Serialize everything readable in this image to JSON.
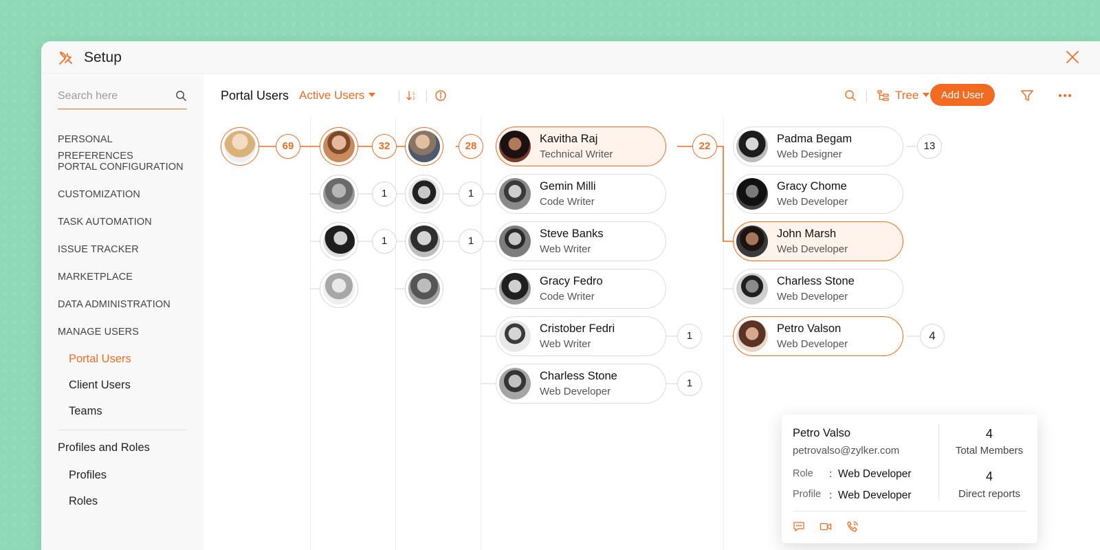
{
  "window": {
    "title": "Setup"
  },
  "sidebar": {
    "search_placeholder": "Search here",
    "items": [
      {
        "label": "PERSONAL PREFERENCES"
      },
      {
        "label": "PORTAL CONFIGURATION"
      },
      {
        "label": "CUSTOMIZATION"
      },
      {
        "label": "TASK AUTOMATION"
      },
      {
        "label": "ISSUE TRACKER"
      },
      {
        "label": "MARKETPLACE"
      },
      {
        "label": "DATA ADMINISTRATION"
      },
      {
        "label": "MANAGE USERS"
      }
    ],
    "manage_users_sub": [
      {
        "label": "Portal Users",
        "active": true
      },
      {
        "label": "Client Users"
      },
      {
        "label": "Teams"
      }
    ],
    "profiles_heading": "Profiles and Roles",
    "profiles_sub": [
      {
        "label": "Profiles"
      },
      {
        "label": "Roles"
      }
    ]
  },
  "toolbar": {
    "title": "Portal Users",
    "filter_label": "Active Users",
    "view_label": "Tree",
    "add_user_label": "Add User"
  },
  "tree": {
    "col1": [
      {
        "count": "69",
        "selected": true,
        "has_count": true
      }
    ],
    "col2": [
      {
        "count": "32",
        "selected": true,
        "has_count": true
      },
      {
        "count": "1",
        "has_count": true
      },
      {
        "count": "1",
        "has_count": true
      },
      {
        "count": "",
        "has_count": false
      }
    ],
    "col3": [
      {
        "count": "28",
        "selected": true,
        "has_count": true
      },
      {
        "count": "1",
        "has_count": true
      },
      {
        "count": "1",
        "has_count": true
      },
      {
        "count": "",
        "has_count": false
      }
    ],
    "col4": [
      {
        "name": "Kavitha Raj",
        "role": "Technical Writer",
        "count": "22",
        "selected": true,
        "has_count": true
      },
      {
        "name": "Gemin Milli",
        "role": "Code Writer",
        "count": "",
        "has_count": false
      },
      {
        "name": "Steve Banks",
        "role": "Web Writer",
        "count": "",
        "has_count": false
      },
      {
        "name": "Gracy Fedro",
        "role": "Code Writer",
        "count": "",
        "has_count": false
      },
      {
        "name": "Cristober Fedri",
        "role": "Web Writer",
        "count": "1",
        "has_count": true
      },
      {
        "name": "Charless Stone",
        "role": "Web Developer",
        "count": "1",
        "has_count": true
      }
    ],
    "col5": [
      {
        "name": "Padma Begam",
        "role": "Web Designer",
        "count": "13",
        "has_count": true
      },
      {
        "name": "Gracy Chome",
        "role": "Web Developer",
        "count": "",
        "has_count": false
      },
      {
        "name": "John Marsh",
        "role": "Web Developer",
        "count": "",
        "has_count": false,
        "selected": true
      },
      {
        "name": "Charless Stone",
        "role": "Web Developer",
        "count": "",
        "has_count": false
      },
      {
        "name": "Petro Valson",
        "role": "Web Developer",
        "count": "4",
        "has_count": true,
        "hovered": true
      }
    ]
  },
  "popover": {
    "name": "Petro Valso",
    "email": "petrovalso@zylker.com",
    "role_label": "Role",
    "role_value": "Web Developer",
    "profile_label": "Profile",
    "profile_value": "Web Developer",
    "colon": ":",
    "total_members": "4",
    "total_members_label": "Total Members",
    "direct_reports": "4",
    "direct_reports_label": "Direct reports",
    "actions": [
      "chat-icon",
      "video-call-icon",
      "phone-call-icon"
    ]
  },
  "colors": {
    "accent": "#f26b21",
    "background": "#8fd9b6"
  }
}
